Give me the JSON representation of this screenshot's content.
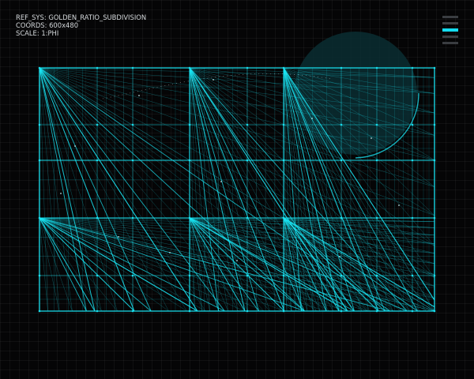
{
  "hud": {
    "ref_sys": "REF_SYS: GOLDEN_RATIO_SUBDIVISION",
    "coords": "COORDS: 600x480",
    "scale": "SCALE: 1:PHI"
  },
  "legend": {
    "items": [
      {
        "active": false
      },
      {
        "active": false
      },
      {
        "active": true
      },
      {
        "active": false
      },
      {
        "active": false
      }
    ]
  },
  "colors": {
    "background": "#050506",
    "grid_line": "#19e6f5",
    "accent": "#14dcf0",
    "circle_fill": "#0a2e33",
    "label_text": "#d6dadd",
    "legend_inactive": "#3a3d41"
  },
  "diagram": {
    "subdivision": "golden-ratio",
    "fans": 6,
    "icons": [
      "bg-circle",
      "arc",
      "dotted-path"
    ]
  }
}
